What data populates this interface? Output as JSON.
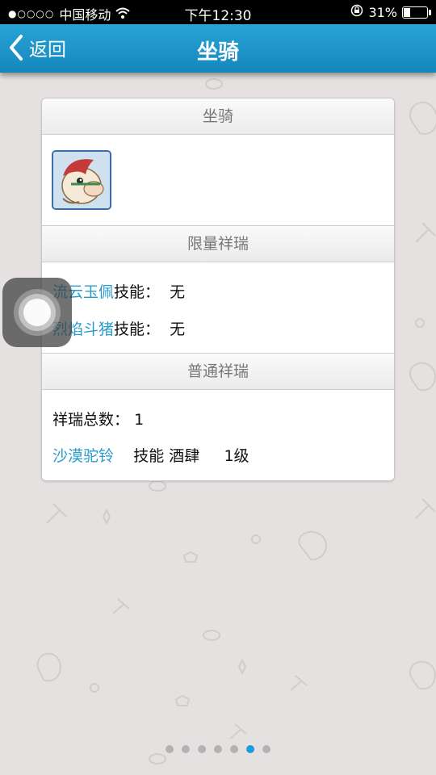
{
  "status_bar": {
    "signal_dots": "●○○○○",
    "carrier": "中国移动",
    "time": "下午12:30",
    "battery_text": "31%",
    "battery_level": 0.31
  },
  "nav": {
    "back_label": "返回",
    "title": "坐骑"
  },
  "card": {
    "mount_header": "坐骑",
    "limited_header": "限量祥瑞",
    "limited_items": [
      {
        "name": "流云玉佩",
        "skill_label": "技能：",
        "skill_value": "无"
      },
      {
        "name": "烈焰斗猪",
        "skill_label": "技能：",
        "skill_value": "无"
      }
    ],
    "normal_header": "普通祥瑞",
    "normal_total_label": "祥瑞总数：",
    "normal_total_value": "1",
    "normal_items": [
      {
        "name": "沙漠驼铃",
        "skill_label": "技能",
        "skill_value": "酒肆",
        "level": "1级"
      }
    ]
  },
  "pagination": {
    "total": 7,
    "active_index": 5
  },
  "colors": {
    "nav": "#1b95cc",
    "link": "#2a9ccc",
    "active_dot": "#1e9be0"
  }
}
